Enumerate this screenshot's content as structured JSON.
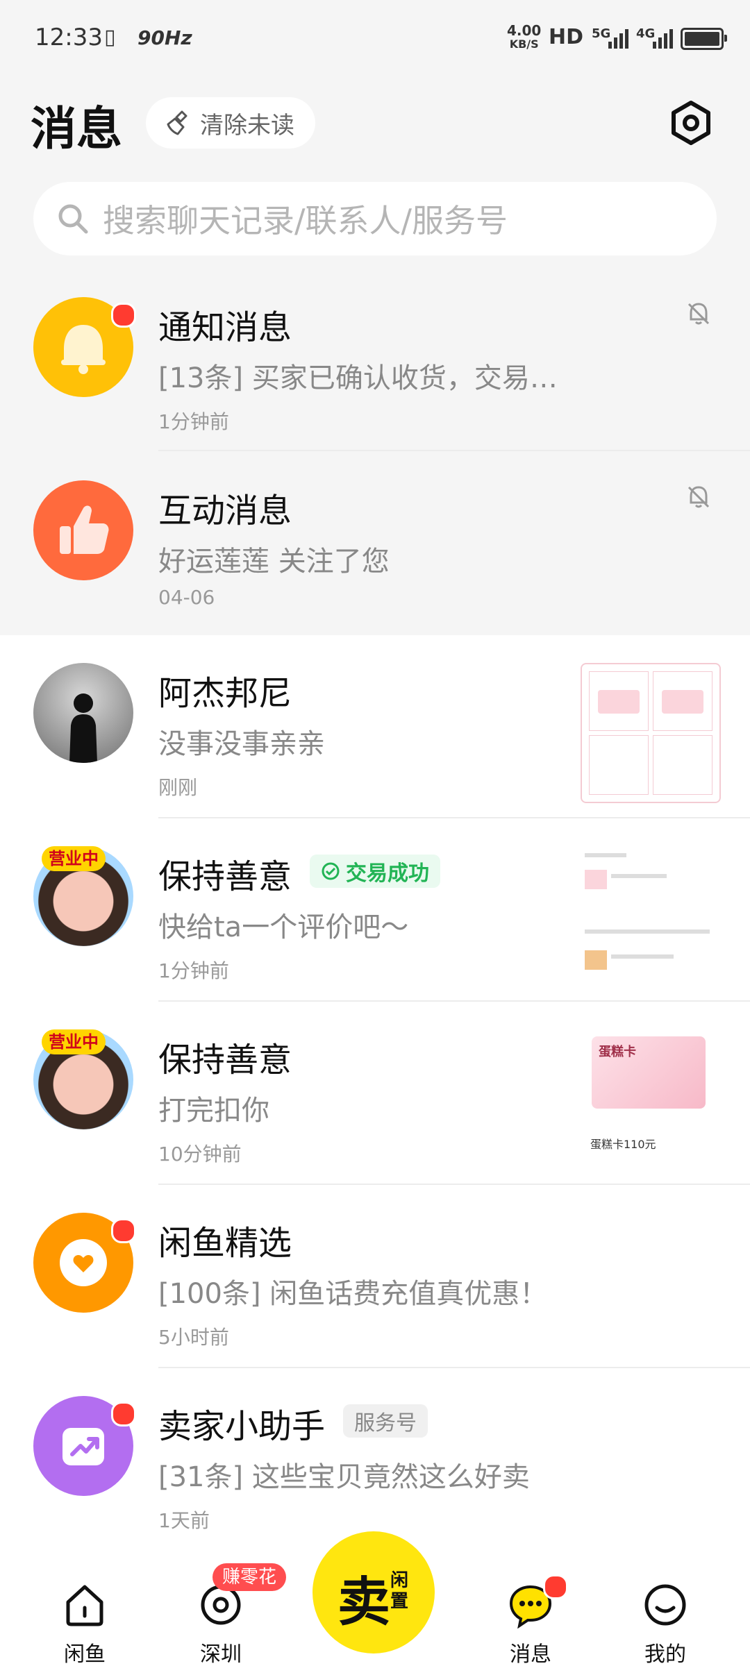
{
  "status_bar": {
    "time": "12:33",
    "refresh_rate": "90Hz",
    "speed_value": "4.00",
    "speed_unit": "KB/S",
    "hd": "HD",
    "net1": "5G",
    "net2": "4G"
  },
  "header": {
    "title": "消息",
    "clear_unread": "清除未读"
  },
  "search": {
    "placeholder": "搜索聊天记录/联系人/服务号"
  },
  "conversations": [
    {
      "name": "通知消息",
      "message": "[13条] 买家已确认收货，交易…",
      "time": "1分钟前",
      "avatar": "bell-icon",
      "color": "#ffc107",
      "unread": true,
      "muted": true
    },
    {
      "name": "互动消息",
      "message": "好运莲莲 关注了您",
      "time": "04-06",
      "avatar": "thumbs-up-icon",
      "color": "#ff6a3d",
      "unread": false,
      "muted": true
    },
    {
      "name": "阿杰邦尼",
      "message": "没事没事亲亲",
      "time": "刚刚",
      "avatar": "silhouette-avatar"
    },
    {
      "name": "保持善意",
      "badge": "交易成功",
      "message": "快给ta一个评价吧～",
      "time": "1分钟前",
      "avatar_badge": "营业中"
    },
    {
      "name": "保持善意",
      "message": "打完扣你",
      "time": "10分钟前",
      "avatar_badge": "营业中",
      "thumb_label": "蛋糕卡",
      "thumb_caption": "蛋糕卡110元"
    },
    {
      "name": "闲鱼精选",
      "message": "[100条] 闲鱼话费充值真优惠！",
      "time": "5小时前",
      "avatar": "heart-icon",
      "color": "#ff9800",
      "unread": true
    },
    {
      "name": "卖家小助手",
      "badge": "服务号",
      "message": "[31条] 这些宝贝竟然这么好卖",
      "time": "1天前",
      "avatar": "trend-icon",
      "color": "#b36ef0",
      "unread": true
    }
  ],
  "bottom_nav": {
    "items": [
      {
        "label": "闲鱼"
      },
      {
        "label": "深圳"
      },
      {
        "label": "消息"
      },
      {
        "label": "我的"
      }
    ],
    "earn_badge": "赚零花",
    "sell_big": "卖",
    "sell_small": "闲置"
  }
}
